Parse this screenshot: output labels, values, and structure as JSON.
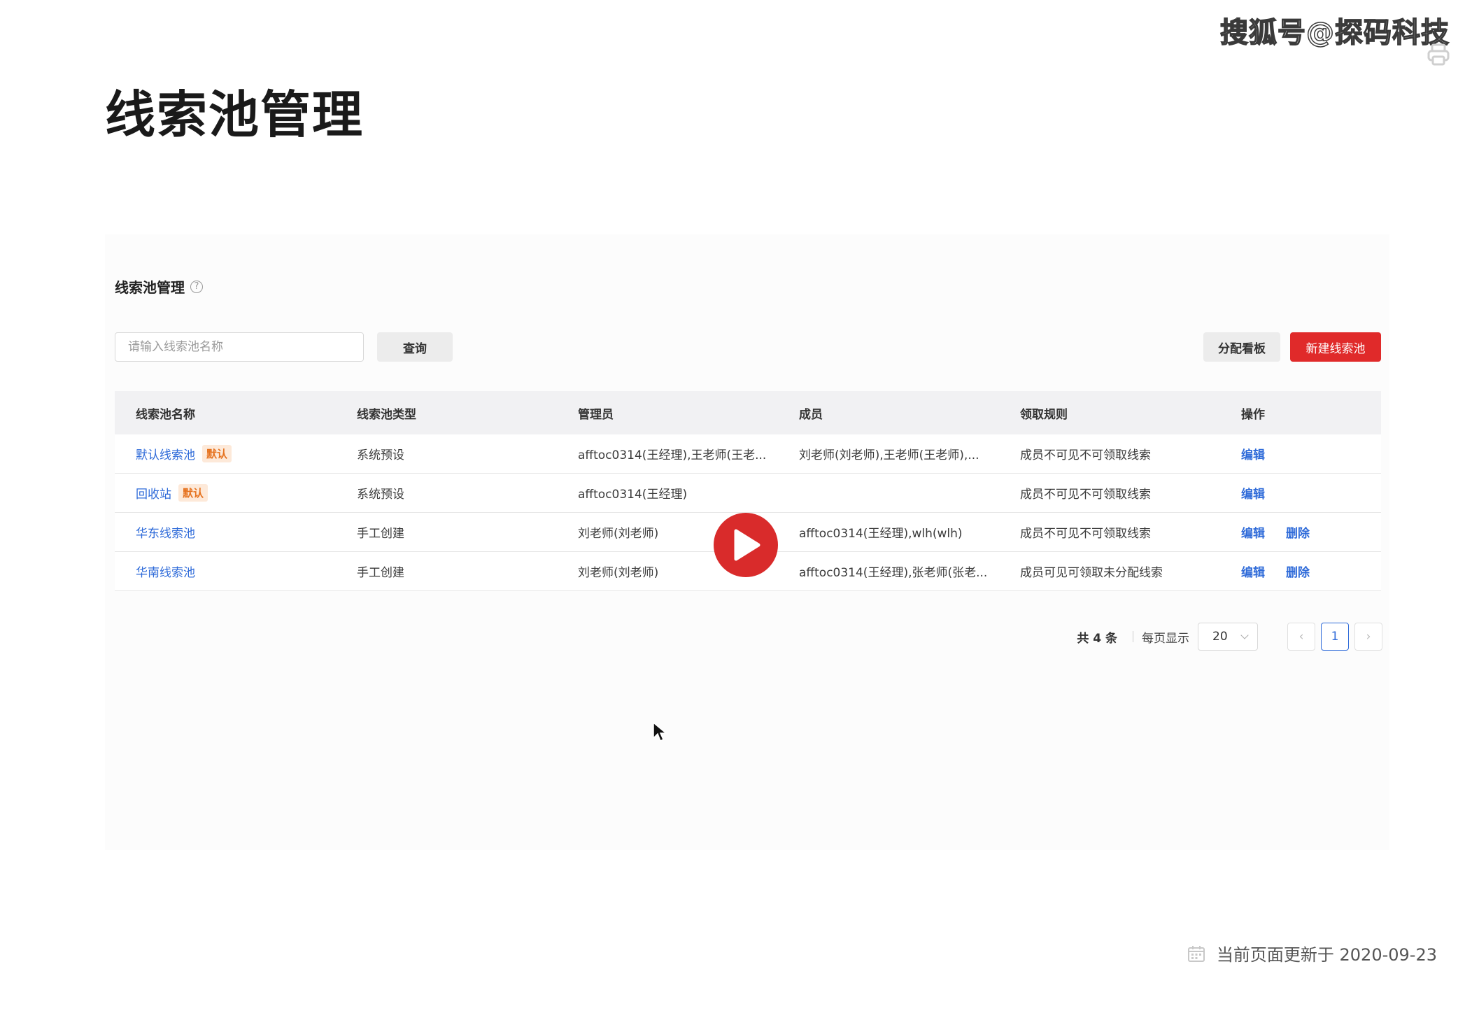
{
  "watermark": "搜狐号@探码科技",
  "page_title": "线索池管理",
  "panel": {
    "title": "线索池管理",
    "help_icon": "?",
    "search_placeholder": "请输入线索池名称",
    "query_label": "查询",
    "board_label": "分配看板",
    "new_label": "新建线索池"
  },
  "table": {
    "headers": [
      "线索池名称",
      "线索池类型",
      "管理员",
      "成员",
      "领取规则",
      "操作"
    ],
    "rows": [
      {
        "name": "默认线索池",
        "badge": "默认",
        "type": "系统预设",
        "admin": "afftoc0314(王经理),王老师(王老...",
        "members": "刘老师(刘老师),王老师(王老师),...",
        "rule": "成员不可见不可领取线索",
        "edit": "编辑",
        "delete": ""
      },
      {
        "name": "回收站",
        "badge": "默认",
        "type": "系统预设",
        "admin": "afftoc0314(王经理)",
        "members": "",
        "rule": "成员不可见不可领取线索",
        "edit": "编辑",
        "delete": ""
      },
      {
        "name": "华东线索池",
        "badge": "",
        "type": "手工创建",
        "admin": "刘老师(刘老师)",
        "members": "afftoc0314(王经理),wlh(wlh)",
        "rule": "成员不可见不可领取线索",
        "edit": "编辑",
        "delete": "删除"
      },
      {
        "name": "华南线索池",
        "badge": "",
        "type": "手工创建",
        "admin": "刘老师(刘老师)",
        "members": "afftoc0314(王经理),张老师(张老...",
        "rule": "成员可见可领取未分配线索",
        "edit": "编辑",
        "delete": "删除"
      }
    ]
  },
  "pagination": {
    "total": "共 4 条",
    "per_page_label": "每页显示",
    "page_size": "20",
    "current_page": "1",
    "prev": "‹",
    "next": "›"
  },
  "footer": {
    "text": "当前页面更新于 2020-09-23"
  },
  "icons": {
    "corner": "print-icon",
    "play": "play-icon",
    "cursor": "cursor-icon",
    "calendar": "calendar-icon"
  },
  "colors": {
    "primary_red": "#e02a2a",
    "link_blue": "#2f6bd9",
    "badge_orange": "#e67320",
    "play_red": "#d92b2b"
  }
}
